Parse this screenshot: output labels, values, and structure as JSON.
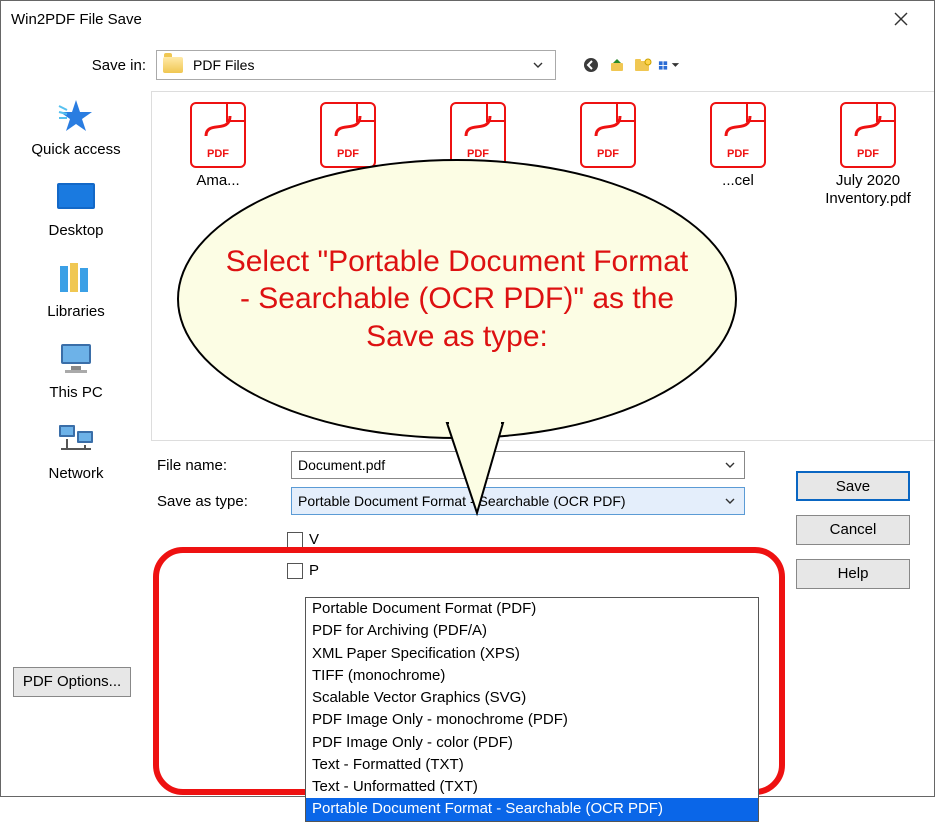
{
  "window": {
    "title": "Win2PDF File Save"
  },
  "toolbar": {
    "save_in_label": "Save in:",
    "save_in_value": "PDF Files",
    "nav_icons": [
      "back-icon",
      "up-icon",
      "new-folder-icon",
      "view-menu-icon"
    ]
  },
  "places": [
    {
      "id": "quick-access",
      "label": "Quick access"
    },
    {
      "id": "desktop",
      "label": "Desktop"
    },
    {
      "id": "libraries",
      "label": "Libraries"
    },
    {
      "id": "this-pc",
      "label": "This PC"
    },
    {
      "id": "network",
      "label": "Network"
    }
  ],
  "files": [
    {
      "label": "Ama...",
      "badge": "PDF"
    },
    {
      "label": "",
      "badge": "PDF"
    },
    {
      "label": "",
      "badge": "PDF"
    },
    {
      "label": "",
      "badge": "PDF"
    },
    {
      "label": "...cel",
      "badge": "PDF"
    },
    {
      "label": "July 2020 Inventory.pdf",
      "badge": "PDF"
    }
  ],
  "form": {
    "file_name_label": "File name:",
    "file_name_value": "Document.pdf",
    "save_as_type_label": "Save as type:",
    "save_as_type_value": "Portable Document Format - Searchable (OCR PDF)",
    "options": [
      "Portable Document Format (PDF)",
      "PDF for Archiving (PDF/A)",
      "XML Paper Specification (XPS)",
      "TIFF (monochrome)",
      "Scalable Vector Graphics (SVG)",
      "PDF Image Only - monochrome (PDF)",
      "PDF Image Only - color (PDF)",
      "Text - Formatted (TXT)",
      "Text - Unformatted (TXT)",
      "Portable Document Format - Searchable (OCR PDF)"
    ],
    "selected_index": 9,
    "check_v": "V",
    "check_p": "P"
  },
  "buttons": {
    "save": "Save",
    "cancel": "Cancel",
    "help": "Help",
    "pdf_options": "PDF Options..."
  },
  "callout": {
    "text": "Select \"Portable Document Format - Searchable (OCR PDF)\" as the Save as type:"
  }
}
